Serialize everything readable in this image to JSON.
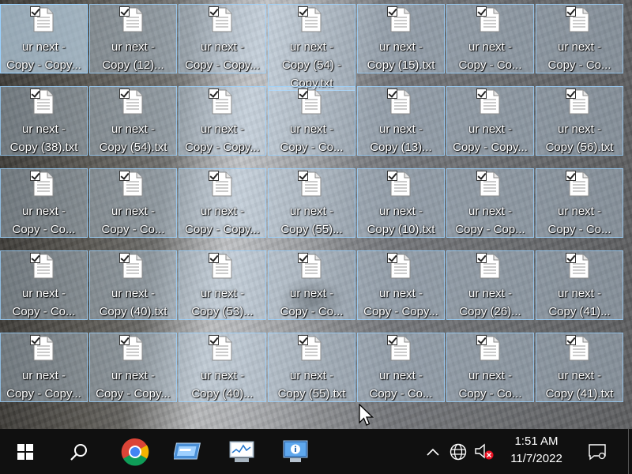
{
  "desktop": {
    "icons": [
      {
        "line1": "ur next -",
        "line2": "Copy - Copy..."
      },
      {
        "line1": "ur next -",
        "line2": "Copy (12)..."
      },
      {
        "line1": "ur next -",
        "line2": "Copy - Copy..."
      },
      {
        "line1": "ur next -",
        "line2": "Copy (54) -",
        "line3": "Copy.txt"
      },
      {
        "line1": "ur next -",
        "line2": "Copy (15).txt"
      },
      {
        "line1": "ur next -",
        "line2": "Copy - Co..."
      },
      {
        "line1": "ur next -",
        "line2": "Copy - Co..."
      },
      {
        "line1": "ur next -",
        "line2": "Copy (38).txt"
      },
      {
        "line1": "ur next -",
        "line2": "Copy (54).txt"
      },
      {
        "line1": "ur next -",
        "line2": "Copy - Copy..."
      },
      {
        "line1": "ur next -",
        "line2": "Copy - Co..."
      },
      {
        "line1": "ur next -",
        "line2": "Copy (13)..."
      },
      {
        "line1": "ur next -",
        "line2": "Copy - Copy..."
      },
      {
        "line1": "ur next -",
        "line2": "Copy (56).txt"
      },
      {
        "line1": "ur next -",
        "line2": "Copy - Co..."
      },
      {
        "line1": "ur next -",
        "line2": "Copy - Co..."
      },
      {
        "line1": "ur next -",
        "line2": "Copy - Copy..."
      },
      {
        "line1": "ur next -",
        "line2": "Copy (55)..."
      },
      {
        "line1": "ur next -",
        "line2": "Copy (10).txt"
      },
      {
        "line1": "ur next -",
        "line2": "Copy - Cop..."
      },
      {
        "line1": "ur next -",
        "line2": "Copy - Co..."
      },
      {
        "line1": "ur next -",
        "line2": "Copy - Co..."
      },
      {
        "line1": "ur next -",
        "line2": "Copy (40).txt"
      },
      {
        "line1": "ur next -",
        "line2": "Copy (53)..."
      },
      {
        "line1": "ur next -",
        "line2": "Copy - Co..."
      },
      {
        "line1": "ur next -",
        "line2": "Copy - Copy..."
      },
      {
        "line1": "ur next -",
        "line2": "Copy (26)..."
      },
      {
        "line1": "ur next -",
        "line2": "Copy (41)..."
      },
      {
        "line1": "ur next -",
        "line2": "Copy - Copy..."
      },
      {
        "line1": "ur next -",
        "line2": "Copy - Copy..."
      },
      {
        "line1": "ur next -",
        "line2": "Copy (40)..."
      },
      {
        "line1": "ur next -",
        "line2": "Copy (55).txt"
      },
      {
        "line1": "ur next -",
        "line2": "Copy - Co..."
      },
      {
        "line1": "ur next -",
        "line2": "Copy - Co..."
      },
      {
        "line1": "ur next -",
        "line2": "Copy (41).txt"
      }
    ]
  },
  "taskbar": {
    "start_icon": "windows-start-icon",
    "search_icon": "search-icon",
    "apps": [
      "chrome-icon",
      "window-switcher-icon",
      "performance-monitor-icon",
      "system-info-icon"
    ],
    "tray": {
      "chevron": "chevron-up-icon",
      "network": "globe-icon",
      "volume": "volume-muted-icon"
    },
    "clock": {
      "time": "1:51 AM",
      "date": "11/7/2022"
    },
    "notification_icon": "notification-icon"
  },
  "colors": {
    "taskbar": "#101010",
    "selection_fill": "#cce8ff",
    "selection_border": "#99d1ff"
  }
}
